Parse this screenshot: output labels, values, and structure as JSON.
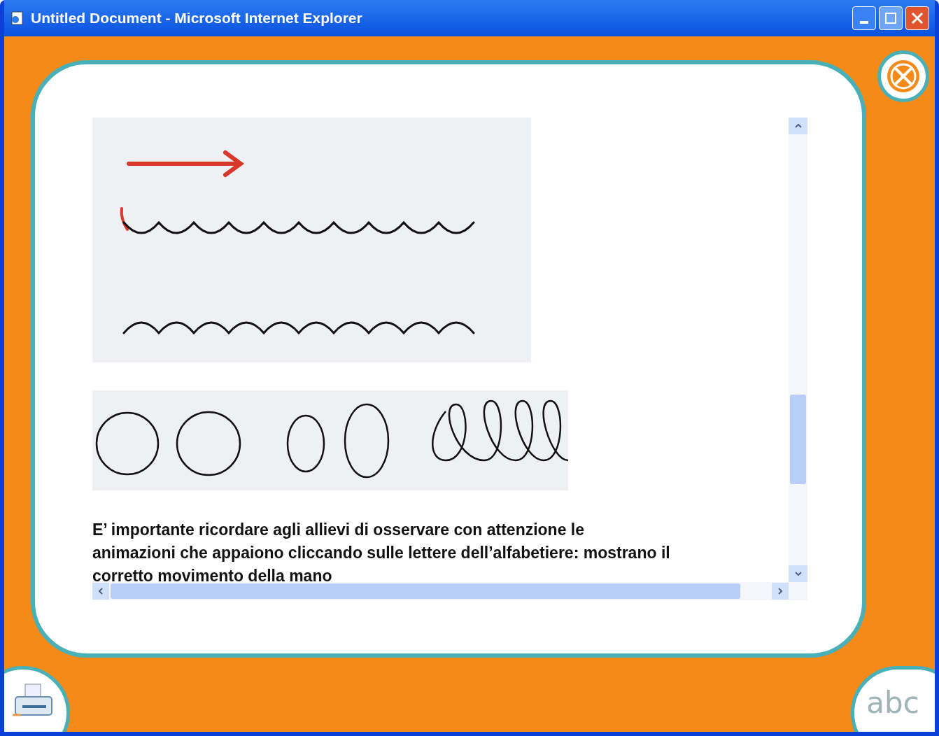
{
  "window": {
    "title": "Untitled Document - Microsoft Internet Explorer"
  },
  "content": {
    "paragraph": "E’ importante ricordare agli allievi di osservare con attenzione le animazioni che appaiono cliccando sulle lettere dell’alfabetiere: mostrano il corretto movimento della mano"
  },
  "corner_buttons": {
    "alphabet_label": "abc"
  }
}
